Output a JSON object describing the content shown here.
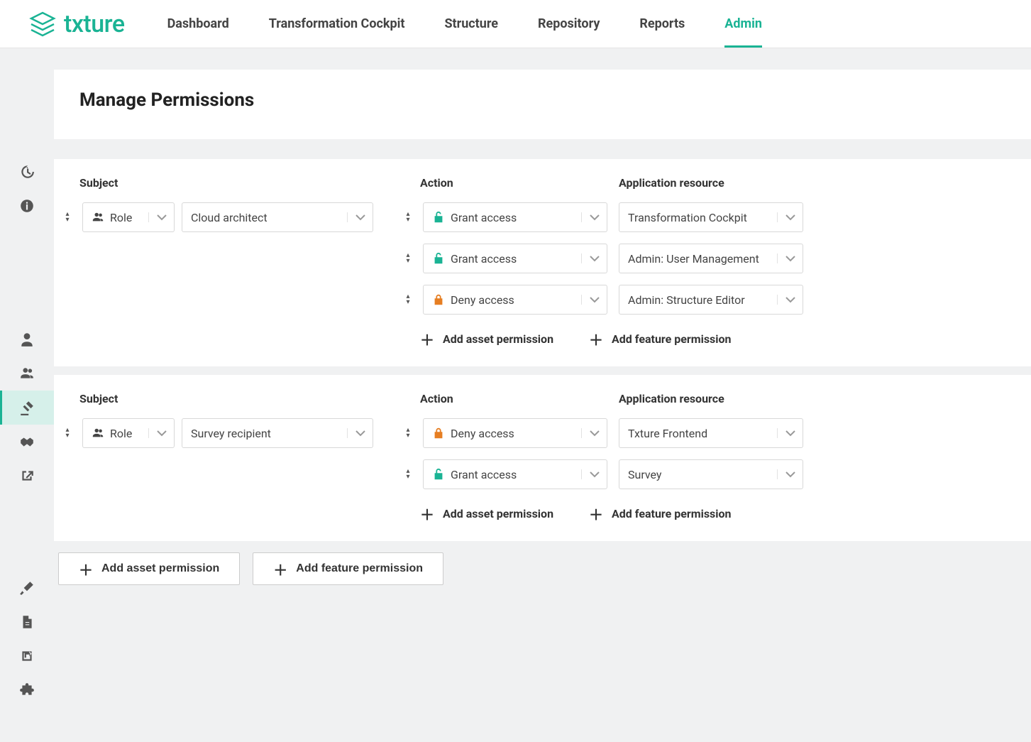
{
  "brand": {
    "name": "txture"
  },
  "topnav": {
    "items": [
      {
        "label": "Dashboard",
        "active": false
      },
      {
        "label": "Transformation Cockpit",
        "active": false
      },
      {
        "label": "Structure",
        "active": false
      },
      {
        "label": "Repository",
        "active": false
      },
      {
        "label": "Reports",
        "active": false
      },
      {
        "label": "Admin",
        "active": true
      }
    ]
  },
  "page": {
    "title": "Manage Permissions"
  },
  "columns": {
    "subject": "Subject",
    "action": "Action",
    "resource": "Application resource"
  },
  "labels": {
    "role": "Role",
    "grant": "Grant access",
    "deny": "Deny access",
    "add_asset": "Add asset permission",
    "add_feature": "Add feature permission"
  },
  "blocks": [
    {
      "subject_type": "Role",
      "subject_value": "Cloud architect",
      "rows": [
        {
          "action": "grant",
          "resource": "Transformation Cockpit"
        },
        {
          "action": "grant",
          "resource": "Admin: User Management"
        },
        {
          "action": "deny",
          "resource": "Admin: Structure Editor"
        }
      ]
    },
    {
      "subject_type": "Role",
      "subject_value": "Survey recipient",
      "rows": [
        {
          "action": "deny",
          "resource": "Txture Frontend"
        },
        {
          "action": "grant",
          "resource": "Survey"
        }
      ]
    }
  ]
}
